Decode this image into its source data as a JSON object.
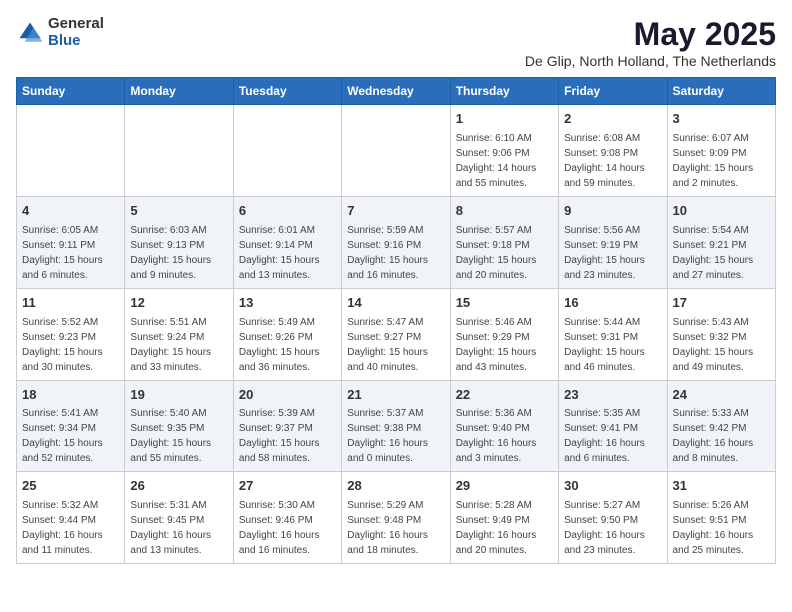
{
  "header": {
    "logo_general": "General",
    "logo_blue": "Blue",
    "main_title": "May 2025",
    "subtitle": "De Glip, North Holland, The Netherlands"
  },
  "weekdays": [
    "Sunday",
    "Monday",
    "Tuesday",
    "Wednesday",
    "Thursday",
    "Friday",
    "Saturday"
  ],
  "weeks": [
    [
      {
        "day": "",
        "info": ""
      },
      {
        "day": "",
        "info": ""
      },
      {
        "day": "",
        "info": ""
      },
      {
        "day": "",
        "info": ""
      },
      {
        "day": "1",
        "info": "Sunrise: 6:10 AM\nSunset: 9:06 PM\nDaylight: 14 hours\nand 55 minutes."
      },
      {
        "day": "2",
        "info": "Sunrise: 6:08 AM\nSunset: 9:08 PM\nDaylight: 14 hours\nand 59 minutes."
      },
      {
        "day": "3",
        "info": "Sunrise: 6:07 AM\nSunset: 9:09 PM\nDaylight: 15 hours\nand 2 minutes."
      }
    ],
    [
      {
        "day": "4",
        "info": "Sunrise: 6:05 AM\nSunset: 9:11 PM\nDaylight: 15 hours\nand 6 minutes."
      },
      {
        "day": "5",
        "info": "Sunrise: 6:03 AM\nSunset: 9:13 PM\nDaylight: 15 hours\nand 9 minutes."
      },
      {
        "day": "6",
        "info": "Sunrise: 6:01 AM\nSunset: 9:14 PM\nDaylight: 15 hours\nand 13 minutes."
      },
      {
        "day": "7",
        "info": "Sunrise: 5:59 AM\nSunset: 9:16 PM\nDaylight: 15 hours\nand 16 minutes."
      },
      {
        "day": "8",
        "info": "Sunrise: 5:57 AM\nSunset: 9:18 PM\nDaylight: 15 hours\nand 20 minutes."
      },
      {
        "day": "9",
        "info": "Sunrise: 5:56 AM\nSunset: 9:19 PM\nDaylight: 15 hours\nand 23 minutes."
      },
      {
        "day": "10",
        "info": "Sunrise: 5:54 AM\nSunset: 9:21 PM\nDaylight: 15 hours\nand 27 minutes."
      }
    ],
    [
      {
        "day": "11",
        "info": "Sunrise: 5:52 AM\nSunset: 9:23 PM\nDaylight: 15 hours\nand 30 minutes."
      },
      {
        "day": "12",
        "info": "Sunrise: 5:51 AM\nSunset: 9:24 PM\nDaylight: 15 hours\nand 33 minutes."
      },
      {
        "day": "13",
        "info": "Sunrise: 5:49 AM\nSunset: 9:26 PM\nDaylight: 15 hours\nand 36 minutes."
      },
      {
        "day": "14",
        "info": "Sunrise: 5:47 AM\nSunset: 9:27 PM\nDaylight: 15 hours\nand 40 minutes."
      },
      {
        "day": "15",
        "info": "Sunrise: 5:46 AM\nSunset: 9:29 PM\nDaylight: 15 hours\nand 43 minutes."
      },
      {
        "day": "16",
        "info": "Sunrise: 5:44 AM\nSunset: 9:31 PM\nDaylight: 15 hours\nand 46 minutes."
      },
      {
        "day": "17",
        "info": "Sunrise: 5:43 AM\nSunset: 9:32 PM\nDaylight: 15 hours\nand 49 minutes."
      }
    ],
    [
      {
        "day": "18",
        "info": "Sunrise: 5:41 AM\nSunset: 9:34 PM\nDaylight: 15 hours\nand 52 minutes."
      },
      {
        "day": "19",
        "info": "Sunrise: 5:40 AM\nSunset: 9:35 PM\nDaylight: 15 hours\nand 55 minutes."
      },
      {
        "day": "20",
        "info": "Sunrise: 5:39 AM\nSunset: 9:37 PM\nDaylight: 15 hours\nand 58 minutes."
      },
      {
        "day": "21",
        "info": "Sunrise: 5:37 AM\nSunset: 9:38 PM\nDaylight: 16 hours\nand 0 minutes."
      },
      {
        "day": "22",
        "info": "Sunrise: 5:36 AM\nSunset: 9:40 PM\nDaylight: 16 hours\nand 3 minutes."
      },
      {
        "day": "23",
        "info": "Sunrise: 5:35 AM\nSunset: 9:41 PM\nDaylight: 16 hours\nand 6 minutes."
      },
      {
        "day": "24",
        "info": "Sunrise: 5:33 AM\nSunset: 9:42 PM\nDaylight: 16 hours\nand 8 minutes."
      }
    ],
    [
      {
        "day": "25",
        "info": "Sunrise: 5:32 AM\nSunset: 9:44 PM\nDaylight: 16 hours\nand 11 minutes."
      },
      {
        "day": "26",
        "info": "Sunrise: 5:31 AM\nSunset: 9:45 PM\nDaylight: 16 hours\nand 13 minutes."
      },
      {
        "day": "27",
        "info": "Sunrise: 5:30 AM\nSunset: 9:46 PM\nDaylight: 16 hours\nand 16 minutes."
      },
      {
        "day": "28",
        "info": "Sunrise: 5:29 AM\nSunset: 9:48 PM\nDaylight: 16 hours\nand 18 minutes."
      },
      {
        "day": "29",
        "info": "Sunrise: 5:28 AM\nSunset: 9:49 PM\nDaylight: 16 hours\nand 20 minutes."
      },
      {
        "day": "30",
        "info": "Sunrise: 5:27 AM\nSunset: 9:50 PM\nDaylight: 16 hours\nand 23 minutes."
      },
      {
        "day": "31",
        "info": "Sunrise: 5:26 AM\nSunset: 9:51 PM\nDaylight: 16 hours\nand 25 minutes."
      }
    ]
  ]
}
